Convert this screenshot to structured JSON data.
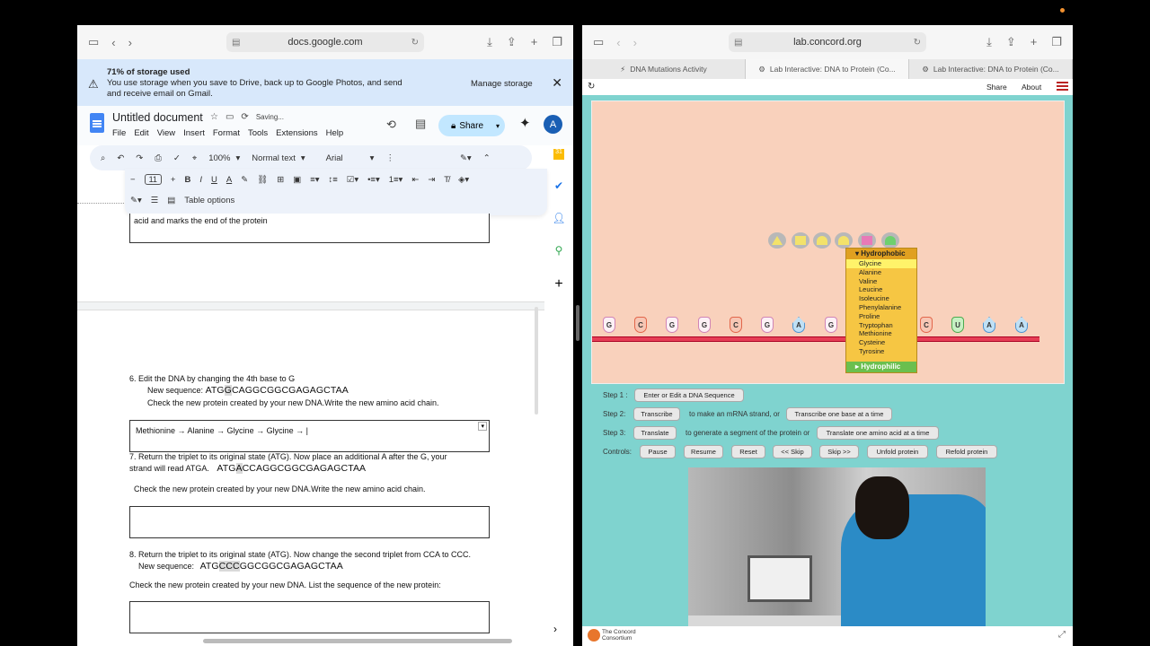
{
  "left": {
    "address": "docs.google.com",
    "banner": {
      "title": "71% of storage used",
      "message": "You use storage when you save to Drive, back up to Google Photos, and send and receive email on Gmail.",
      "action": "Manage storage"
    },
    "doc": {
      "title": "Untitled document",
      "status": "Saving...",
      "menu": [
        "File",
        "Edit",
        "View",
        "Insert",
        "Format",
        "Tools",
        "Extensions",
        "Help"
      ],
      "share": "Share",
      "avatar": "A"
    },
    "toolbar": {
      "zoom": "100%",
      "style": "Normal text",
      "font": "Arial",
      "font_size": "11",
      "table_options": "Table options"
    },
    "content": {
      "prev_answer": "acid and marks the end of the protein",
      "q6": "6. Edit the DNA by changing  the 4th base to G",
      "q6_seq_label": "New sequence:",
      "q6_seq_a": "ATG",
      "q6_seq_hl": "G",
      "q6_seq_b": "CAGGCGGCGAGAGCTAA",
      "q6_check": "Check the new protein created by your new DNA.Write the new amino acid chain.",
      "q6_answer": "Methionine → Alanine → Glycine → Glycine → |",
      "q7_line1": "7. Return the triplet  to its original state (ATG). Now place an additional A after the G, your",
      "q7_line2": "strand will read ATGA.",
      "q7_seq_a": "ATG",
      "q7_seq_hl": "A",
      "q7_seq_b": "CCAGGCGGCGAGAGCTAA",
      "q7_check": "Check the new protein created by your new DNA.Write the new amino acid chain.",
      "q8_line1": "8. Return the triplet to its original state (ATG). Now change the second triplet from CCA to CCC.",
      "q8_seq_label": "New sequence:",
      "q8_seq_a": "ATG",
      "q8_seq_hl": "CCC",
      "q8_seq_b": "GGCGGCGAGAGCTAA",
      "q8_check": "Check the new protein created by your new DNA. List the sequence of the new protein:"
    }
  },
  "right": {
    "address": "lab.concord.org",
    "tabs": [
      "DNA Mutations Activity",
      "Lab Interactive: DNA to Protein (Co...",
      "Lab Interactive: DNA to Protein (Co..."
    ],
    "share": "Share",
    "about": "About",
    "bases": [
      "G",
      "C",
      "G",
      "G",
      "C",
      "G",
      "A",
      "G",
      "C",
      "U",
      "A",
      "A"
    ],
    "aa_menu": {
      "header": "Hydrophobic",
      "items": [
        "Glycine",
        "Alanine",
        "Valine",
        "Leucine",
        "Isoleucine",
        "Phenylalanine",
        "Proline",
        "Tryptophan",
        "Methionine",
        "Cysteine",
        "Tyrosine"
      ],
      "footer": "Hydrophilic"
    },
    "steps": {
      "s1": "Step 1 :",
      "s1_btn": "Enter or Edit a DNA Sequence",
      "s2": "Step 2:",
      "s2_btn": "Transcribe",
      "s2_text": "to make an mRNA strand, or",
      "s2_btn2": "Transcribe one base at a time",
      "s3": "Step 3:",
      "s3_btn": "Translate",
      "s3_text": "to generate a segment of the protein or",
      "s3_btn2": "Translate one amino acid at a time",
      "controls": "Controls:",
      "pause": "Pause",
      "resume": "Resume",
      "reset": "Reset",
      "skip_back": "<< Skip",
      "skip_fwd": "Skip >>",
      "unfold": "Unfold protein",
      "refold": "Refold protein"
    },
    "footer_logo": "The Concord Consortium"
  }
}
